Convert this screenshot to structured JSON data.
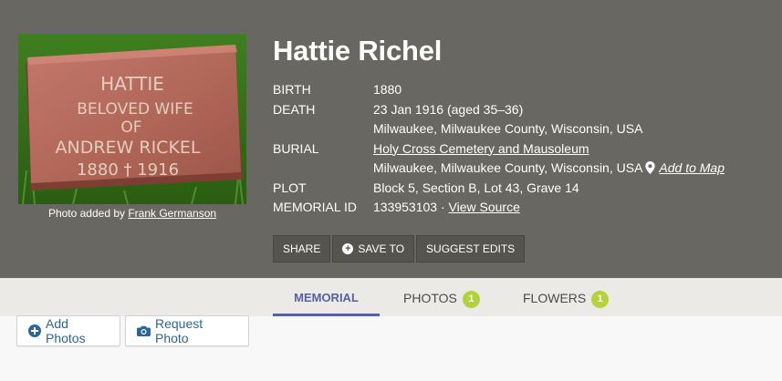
{
  "person": {
    "name": "Hattie Richel"
  },
  "photo": {
    "credit_prefix": "Photo added by ",
    "credit_name": "Frank Germanson",
    "inscription_lines": [
      "HATTIE",
      "BELOVED WIFE",
      "OF",
      "ANDREW RICKEL",
      "1880 † 1916"
    ]
  },
  "facts": {
    "birth_label": "BIRTH",
    "birth_value": "1880",
    "death_label": "DEATH",
    "death_date": "23 Jan 1916 (aged 35–36)",
    "death_place": "Milwaukee, Milwaukee County, Wisconsin, USA",
    "burial_label": "BURIAL",
    "burial_cemetery": "Holy Cross Cemetery and Mausoleum",
    "burial_place": "Milwaukee, Milwaukee County, Wisconsin, USA",
    "add_to_map": "Add to Map",
    "plot_label": "PLOT",
    "plot_value": "Block 5, Section B, Lot 43, Grave 14",
    "memorial_id_label": "MEMORIAL ID",
    "memorial_id_value": "133953103 · ",
    "view_source": "View Source"
  },
  "actions": {
    "share": "SHARE",
    "save_to": "SAVE TO",
    "suggest_edits": "SUGGEST EDITS"
  },
  "tabs": {
    "memorial": "MEMORIAL",
    "photos": "PHOTOS",
    "photos_count": "1",
    "flowers": "FLOWERS",
    "flowers_count": "1"
  },
  "content_actions": {
    "add_photos": "Add Photos",
    "request_photo": "Request Photo"
  },
  "colors": {
    "hero_background": "#686762",
    "tab_active": "#5561a3",
    "badge": "#b3d23a",
    "link_blue": "#2b6796"
  },
  "icons": {
    "map_pin": "map-pin-icon",
    "save_plus": "plus-circle-icon",
    "add_photos": "plus-circle-icon",
    "request_photo": "camera-icon"
  }
}
